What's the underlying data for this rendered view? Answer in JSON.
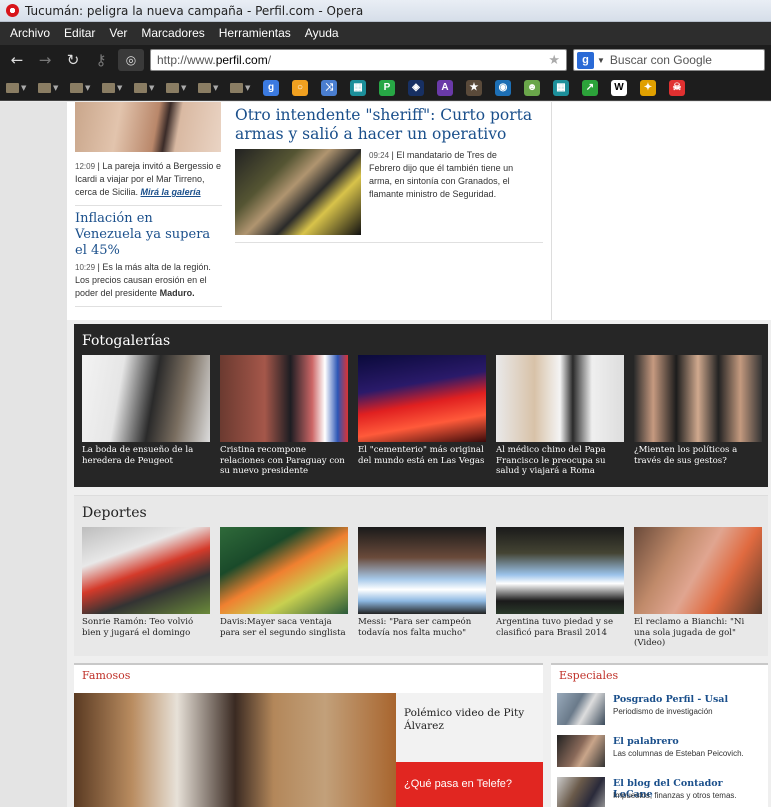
{
  "window": {
    "title": "Tucumán: peligra la nueva campaña - Perfil.com - Opera"
  },
  "menu": [
    "Archivo",
    "Editar",
    "Ver",
    "Marcadores",
    "Herramientas",
    "Ayuda"
  ],
  "address": {
    "prefix": "http://www.",
    "domain": "perfil.com",
    "suffix": "/",
    "search_placeholder": "Buscar con Google"
  },
  "bookmark_icons": [
    {
      "name": "google-icon",
      "color": "#3b7ae0",
      "glyph": "g"
    },
    {
      "name": "orange-circle-icon",
      "color": "#f0a020",
      "glyph": "○"
    },
    {
      "name": "map-icon",
      "color": "#4a7ed0",
      "glyph": "⤨"
    },
    {
      "name": "page-icon",
      "color": "#1c8f9a",
      "glyph": "▦"
    },
    {
      "name": "p-icon",
      "color": "#27a745",
      "glyph": "P"
    },
    {
      "name": "blue-icon",
      "color": "#173063",
      "glyph": "◈"
    },
    {
      "name": "ar-icon",
      "color": "#6a3aa8",
      "glyph": "A"
    },
    {
      "name": "star-box-icon",
      "color": "#5a4a3a",
      "glyph": "★"
    },
    {
      "name": "globe-icon",
      "color": "#1d6fb5",
      "glyph": "◉"
    },
    {
      "name": "frog-icon",
      "color": "#6aa64a",
      "glyph": "☻"
    },
    {
      "name": "doc-icon",
      "color": "#1c8f9a",
      "glyph": "▦"
    },
    {
      "name": "arrow-icon",
      "color": "#2ca33a",
      "glyph": "↗"
    },
    {
      "name": "wikipedia-icon",
      "color": "#ffffff",
      "glyph": "W"
    },
    {
      "name": "torch-icon",
      "color": "#e0a000",
      "glyph": "✦"
    },
    {
      "name": "skull-icon",
      "color": "#e03030",
      "glyph": "☠"
    }
  ],
  "top": {
    "left_1": {
      "time": "12:09",
      "text": "La pareja invitó a Bergessio e Icardi a viajar por el Mar Tirreno, cerca de Sicilia.",
      "link": "Mirá la galería"
    },
    "left_2": {
      "headline": "Inflación en Venezuela ya supera el 45%",
      "time": "10:29",
      "text": "Es la más alta de la región. Los precios causan erosión en el poder del presidente",
      "bold": "Maduro."
    },
    "main": {
      "headline": "Otro intendente \"sheriff\": Curto porta armas y salió a hacer un operativo",
      "time": "09:24",
      "text": "El mandatario de Tres de Febrero dijo que él también tiene un arma, en sintonía con Granados, el flamante ministro de Seguridad."
    }
  },
  "fotogalerias": {
    "title": "Fotogalerías",
    "cards": [
      {
        "caption": "La boda de ensueño de la heredera de Peugeot"
      },
      {
        "caption": "Cristina recompone relaciones con Paraguay con su nuevo presidente"
      },
      {
        "caption": "El \"cementerio\" más original del mundo está en Las Vegas"
      },
      {
        "caption": "Al médico chino del Papa Francisco le preocupa su salud y viajará a Roma"
      },
      {
        "caption": "¿Mienten los políticos a través de sus gestos?"
      }
    ]
  },
  "deportes": {
    "title": "Deportes",
    "cards": [
      {
        "caption": "Sonrie Ramón: Teo volvió bien y jugará el domingo"
      },
      {
        "caption": "Davis:Mayer saca ventaja para ser el segundo singlista"
      },
      {
        "caption": "Messi: \"Para ser campeón todavía nos falta mucho\""
      },
      {
        "caption": "Argentina tuvo piedad y se clasificó para Brasil 2014"
      },
      {
        "caption": "El reclamo a Bianchi: \"Ni una sola jugada de gol\" (Video)"
      }
    ]
  },
  "famosos": {
    "title": "Famosos",
    "headline": "Polémico video de Pity Álvarez",
    "promo": "¿Qué pasa en Telefe?"
  },
  "especiales": {
    "title": "Especiales",
    "items": [
      {
        "title": "Posgrado Perfil - Usal",
        "desc": "Periodismo de investigación"
      },
      {
        "title": "El palabrero",
        "desc": "Las columnas de Esteban Peicovich."
      },
      {
        "title": "El blog del Contador LoCane",
        "desc": "Impuestos, finanzas y otros temas."
      }
    ]
  }
}
